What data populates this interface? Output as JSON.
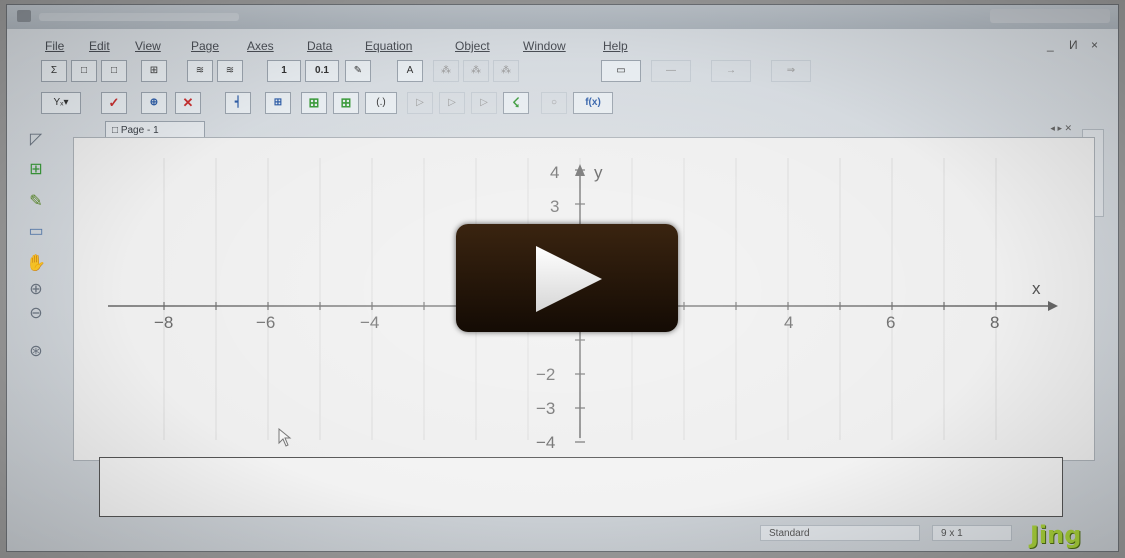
{
  "window": {
    "menu": [
      "File",
      "Edit",
      "View",
      "Page",
      "Axes",
      "Data",
      "Equation",
      "Object",
      "Window",
      "Help"
    ],
    "mdi_controls": [
      "_",
      "И",
      "×"
    ]
  },
  "toolbar": {
    "row1": [
      "Σ",
      "□",
      "□",
      "⊞",
      "≋",
      "≋",
      "1",
      "0.1",
      "✎",
      "A",
      "⁂",
      "⁂",
      "⁂",
      "▭",
      "—",
      "→",
      "⇒"
    ],
    "row2": [
      "Yₓ▾",
      "✓",
      "⊕",
      "✕",
      "┥",
      "⊞",
      "⊞",
      "⊞",
      "(.)",
      "▷",
      "▷",
      "▷",
      "☇",
      "○",
      "f(x)"
    ]
  },
  "left_tools": [
    "cursor-tool-icon",
    "add-object-icon",
    "pencil-icon",
    "eraser-icon",
    "hand-icon",
    "zoom-in-icon",
    "zoom-out-icon",
    "zoom-fit-icon"
  ],
  "page_tab": {
    "label": "Page - 1"
  },
  "graph": {
    "x_axis_label": "x",
    "y_axis_label": "y",
    "x_ticks": [
      "−8",
      "−6",
      "−4",
      "4",
      "6",
      "8"
    ],
    "y_ticks": [
      "4",
      "3",
      "−2",
      "−3",
      "−4"
    ]
  },
  "entry": {
    "value": ""
  },
  "status": {
    "mode": "Standard",
    "coords": "9 x 1"
  },
  "watermark": "Jing",
  "video": {
    "state": "paused"
  }
}
